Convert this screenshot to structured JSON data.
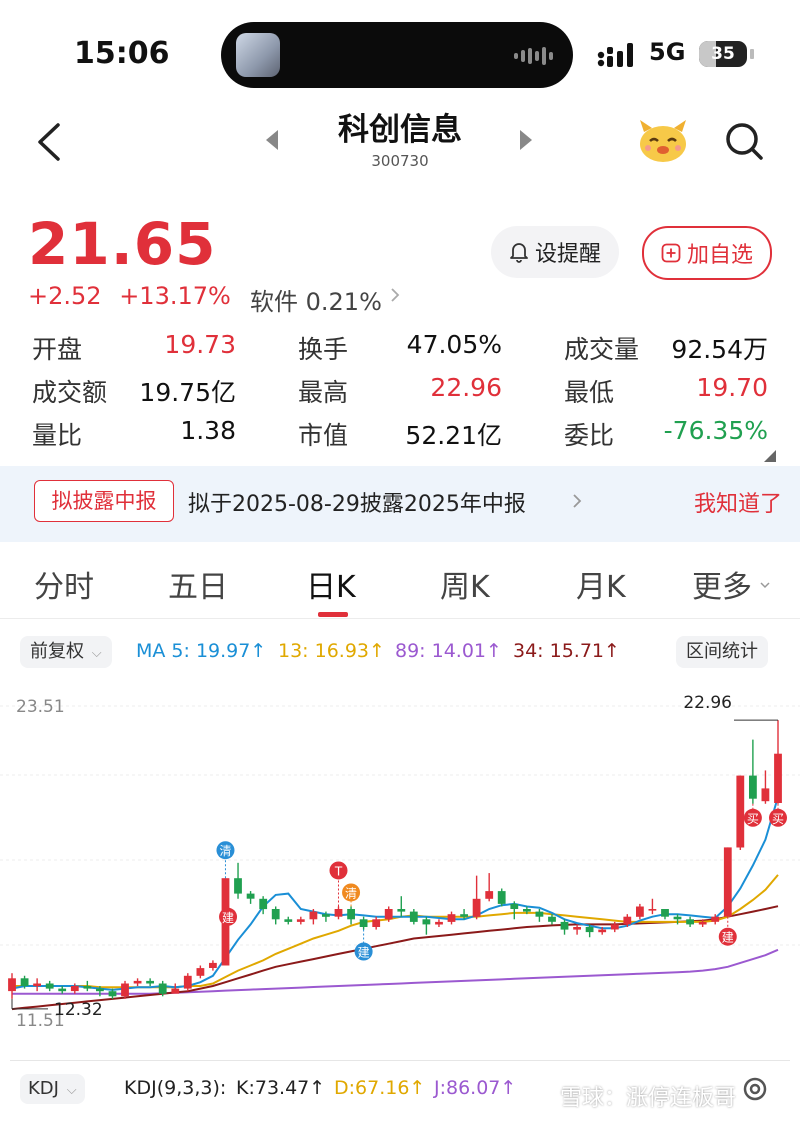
{
  "status_bar": {
    "time": "15:06",
    "network": "5G",
    "battery": "35",
    "battery_level": 0.35
  },
  "header": {
    "title": "科创信息",
    "code": "300730"
  },
  "quote": {
    "price": "21.65",
    "change": "+2.52",
    "change_pct": "+13.17%",
    "sector": "软件 0.21%",
    "alert_label": "设提醒",
    "favorite_label": "加自选"
  },
  "stats": [
    [
      {
        "label": "开盘",
        "value": "19.73",
        "color": "red"
      },
      {
        "label": "换手",
        "value": "47.05%",
        "color": "dark"
      },
      {
        "label": "成交量",
        "value": "92.54万",
        "color": "dark"
      }
    ],
    [
      {
        "label": "成交额",
        "value": "19.75亿",
        "color": "dark"
      },
      {
        "label": "最高",
        "value": "22.96",
        "color": "red"
      },
      {
        "label": "最低",
        "value": "19.70",
        "color": "red"
      }
    ],
    [
      {
        "label": "量比",
        "value": "1.38",
        "color": "dark"
      },
      {
        "label": "市值",
        "value": "52.21亿",
        "color": "dark"
      },
      {
        "label": "委比",
        "value": "-76.35%",
        "color": "green"
      }
    ]
  ],
  "banner": {
    "tag": "拟披露中报",
    "text": "拟于2025-08-29披露2025年中报",
    "dismiss": "我知道了"
  },
  "tabs": [
    "分时",
    "五日",
    "日K",
    "周K",
    "月K",
    "更多"
  ],
  "active_tab": "日K",
  "indicators": {
    "adjust": "前复权",
    "ma5": "MA 5: 19.97↑",
    "ma13": "13: 16.93↑",
    "ma89": "89: 14.01↑",
    "ma34": "34: 15.71↑",
    "range_stats": "区间统计"
  },
  "colors": {
    "up": "#e0303a",
    "down": "#20a050",
    "ma5": "#1a8fd6",
    "ma13": "#e0a800",
    "ma89": "#9b59d0",
    "ma34": "#8b1a1a"
  },
  "chart_data": {
    "type": "candlestick",
    "y_top_label": "23.51",
    "y_bottom_label": "11.51",
    "ylim": [
      11.51,
      23.51
    ],
    "max_label": "22.96",
    "min_label": "12.32",
    "markers": [
      "清",
      "建",
      "T",
      "清",
      "建",
      "建",
      "买",
      "买"
    ],
    "candles": [
      [
        12.4,
        12.9,
        12.1,
        13.1
      ],
      [
        12.9,
        12.6,
        12.5,
        13.0
      ],
      [
        12.6,
        12.7,
        12.4,
        12.9
      ],
      [
        12.7,
        12.5,
        12.4,
        12.8
      ],
      [
        12.5,
        12.4,
        12.3,
        12.6
      ],
      [
        12.4,
        12.6,
        12.3,
        12.7
      ],
      [
        12.6,
        12.5,
        12.4,
        12.8
      ],
      [
        12.5,
        12.4,
        12.2,
        12.6
      ],
      [
        12.4,
        12.2,
        12.1,
        12.5
      ],
      [
        12.2,
        12.7,
        12.1,
        12.8
      ],
      [
        12.7,
        12.8,
        12.6,
        12.9
      ],
      [
        12.8,
        12.7,
        12.6,
        12.9
      ],
      [
        12.7,
        12.3,
        12.2,
        12.8
      ],
      [
        12.3,
        12.5,
        12.32,
        12.7
      ],
      [
        12.5,
        13.0,
        12.4,
        13.1
      ],
      [
        13.0,
        13.3,
        12.9,
        13.4
      ],
      [
        13.3,
        13.5,
        13.2,
        13.6
      ],
      [
        13.4,
        16.8,
        13.4,
        16.8
      ],
      [
        16.8,
        16.2,
        16.0,
        17.4
      ],
      [
        16.2,
        16.0,
        15.8,
        16.3
      ],
      [
        16.0,
        15.6,
        15.4,
        16.1
      ],
      [
        15.6,
        15.2,
        15.0,
        15.7
      ],
      [
        15.2,
        15.1,
        15.0,
        15.3
      ],
      [
        15.1,
        15.2,
        15.0,
        15.3
      ],
      [
        15.2,
        15.5,
        15.0,
        15.6
      ],
      [
        15.4,
        15.3,
        15.1,
        15.5
      ],
      [
        15.3,
        15.6,
        15.2,
        15.7
      ],
      [
        15.6,
        15.2,
        15.0,
        15.7
      ],
      [
        15.2,
        14.9,
        14.8,
        15.3
      ],
      [
        14.9,
        15.2,
        14.8,
        15.3
      ],
      [
        15.2,
        15.6,
        15.1,
        15.7
      ],
      [
        15.6,
        15.5,
        15.3,
        16.1
      ],
      [
        15.5,
        15.1,
        15.0,
        15.6
      ],
      [
        15.2,
        15.0,
        14.6,
        15.3
      ],
      [
        15.0,
        15.1,
        14.9,
        15.2
      ],
      [
        15.1,
        15.4,
        15.0,
        15.5
      ],
      [
        15.4,
        15.3,
        15.2,
        15.6
      ],
      [
        15.3,
        16.0,
        15.2,
        16.9
      ],
      [
        16.0,
        16.3,
        15.9,
        17.0
      ],
      [
        16.3,
        15.8,
        15.7,
        16.4
      ],
      [
        15.8,
        15.6,
        15.2,
        15.9
      ],
      [
        15.6,
        15.5,
        15.4,
        15.7
      ],
      [
        15.5,
        15.3,
        15.1,
        15.6
      ],
      [
        15.3,
        15.1,
        15.0,
        15.4
      ],
      [
        15.1,
        14.8,
        14.6,
        15.2
      ],
      [
        14.8,
        14.9,
        14.6,
        15.0
      ],
      [
        14.9,
        14.7,
        14.5,
        15.0
      ],
      [
        14.7,
        14.8,
        14.6,
        14.9
      ],
      [
        14.8,
        15.0,
        14.7,
        15.1
      ],
      [
        15.0,
        15.3,
        14.9,
        15.4
      ],
      [
        15.3,
        15.7,
        15.2,
        15.8
      ],
      [
        15.6,
        15.6,
        15.4,
        16.0
      ],
      [
        15.6,
        15.3,
        15.2,
        15.6
      ],
      [
        15.3,
        15.2,
        15.0,
        15.4
      ],
      [
        15.2,
        15.0,
        14.9,
        15.3
      ],
      [
        15.0,
        15.1,
        14.9,
        15.2
      ],
      [
        15.1,
        15.3,
        15.0,
        15.4
      ],
      [
        15.3,
        18.0,
        15.3,
        18.0
      ],
      [
        18.0,
        20.8,
        17.9,
        20.8
      ],
      [
        20.8,
        19.9,
        19.7,
        22.2
      ],
      [
        19.8,
        20.3,
        19.7,
        21.0
      ],
      [
        19.73,
        21.65,
        19.7,
        22.96
      ]
    ],
    "ma5": [
      12.5,
      12.6,
      12.6,
      12.6,
      12.6,
      12.6,
      12.55,
      12.5,
      12.45,
      12.5,
      12.55,
      12.55,
      12.6,
      12.55,
      12.6,
      12.75,
      13.0,
      13.7,
      14.4,
      15.0,
      15.7,
      16.15,
      16.2,
      15.6,
      15.5,
      15.4,
      15.35,
      15.4,
      15.35,
      15.3,
      15.3,
      15.3,
      15.3,
      15.3,
      15.25,
      15.2,
      15.2,
      15.35,
      15.6,
      15.75,
      15.8,
      15.7,
      15.65,
      15.45,
      15.2,
      15.05,
      14.95,
      14.85,
      14.85,
      14.95,
      15.15,
      15.3,
      15.4,
      15.4,
      15.35,
      15.3,
      15.25,
      15.7,
      16.4,
      17.3,
      18.3,
      19.97
    ],
    "ma13": [
      12.6,
      12.6,
      12.6,
      12.6,
      12.6,
      12.6,
      12.6,
      12.55,
      12.55,
      12.55,
      12.55,
      12.55,
      12.55,
      12.55,
      12.6,
      12.6,
      12.7,
      12.95,
      13.2,
      13.4,
      13.6,
      13.85,
      14.05,
      14.25,
      14.45,
      14.6,
      14.75,
      14.95,
      15.1,
      15.15,
      15.2,
      15.3,
      15.35,
      15.3,
      15.3,
      15.3,
      15.3,
      15.3,
      15.35,
      15.4,
      15.45,
      15.45,
      15.45,
      15.4,
      15.35,
      15.3,
      15.25,
      15.2,
      15.15,
      15.1,
      15.1,
      15.1,
      15.1,
      15.1,
      15.1,
      15.1,
      15.15,
      15.3,
      15.6,
      15.95,
      16.35,
      16.93
    ],
    "ma34": [
      11.7,
      11.75,
      11.8,
      11.85,
      11.9,
      11.95,
      12.0,
      12.05,
      12.1,
      12.15,
      12.2,
      12.25,
      12.3,
      12.35,
      12.4,
      12.5,
      12.6,
      12.75,
      12.9,
      13.05,
      13.2,
      13.35,
      13.45,
      13.55,
      13.65,
      13.75,
      13.85,
      13.95,
      14.05,
      14.15,
      14.25,
      14.35,
      14.45,
      14.5,
      14.55,
      14.6,
      14.65,
      14.7,
      14.75,
      14.8,
      14.85,
      14.9,
      14.93,
      14.96,
      14.98,
      15.0,
      15.0,
      15.0,
      15.0,
      15.02,
      15.04,
      15.06,
      15.08,
      15.1,
      15.12,
      15.15,
      15.2,
      15.3,
      15.4,
      15.5,
      15.6,
      15.71
    ],
    "ma89": [
      12.3,
      12.3,
      12.3,
      12.3,
      12.3,
      12.3,
      12.3,
      12.3,
      12.3,
      12.3,
      12.3,
      12.3,
      12.32,
      12.34,
      12.36,
      12.38,
      12.4,
      12.42,
      12.44,
      12.46,
      12.48,
      12.5,
      12.52,
      12.54,
      12.56,
      12.58,
      12.6,
      12.62,
      12.64,
      12.66,
      12.68,
      12.7,
      12.72,
      12.74,
      12.76,
      12.78,
      12.8,
      12.82,
      12.84,
      12.86,
      12.88,
      12.9,
      12.92,
      12.94,
      12.96,
      12.98,
      13.0,
      13.02,
      13.04,
      13.06,
      13.08,
      13.1,
      13.12,
      13.14,
      13.16,
      13.2,
      13.26,
      13.35,
      13.5,
      13.65,
      13.8,
      14.01
    ]
  },
  "kdj": {
    "pill": "KDJ",
    "label": "KDJ(9,3,3):",
    "k": "K:73.47↑",
    "d": "D:67.16↑",
    "j": "J:86.07↑"
  },
  "watermark": "雪球：涨停连板哥"
}
